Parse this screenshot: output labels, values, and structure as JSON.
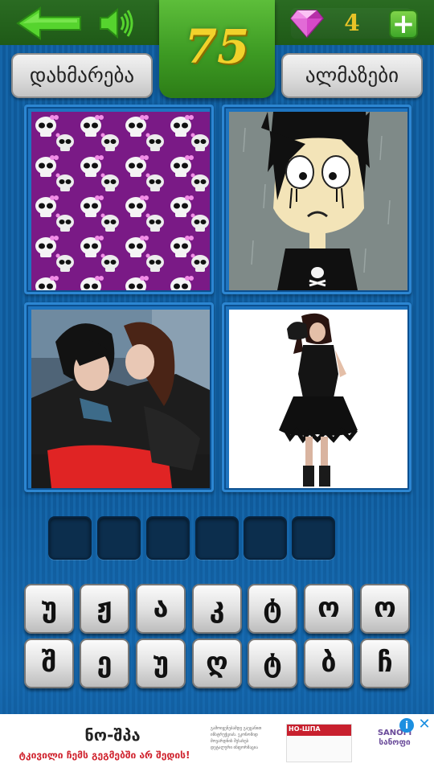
{
  "header": {
    "level": "75",
    "gems": "4",
    "add_label": "+"
  },
  "buttons": {
    "help": "დახმარება",
    "gems": "ალმაზები"
  },
  "pictures": [
    {
      "name": "skull-pattern-picture"
    },
    {
      "name": "sad-emo-cartoon-picture"
    },
    {
      "name": "emo-couple-picture"
    },
    {
      "name": "girl-black-dress-picture"
    }
  ],
  "answer": {
    "slot_count": 6
  },
  "keyboard": {
    "row1": [
      "უ",
      "ჟ",
      "ა",
      "კ",
      "ტ",
      "ო",
      "ო"
    ],
    "row2": [
      "შ",
      "ე",
      "უ",
      "ღ",
      "ტ",
      "ბ",
      "ჩ"
    ]
  },
  "ad": {
    "title": "ნო-შპა",
    "subtitle": "ტკივილი ჩემს გეგმებში არ შედის!",
    "fine_print": "გამოიყენებამდე გაეცანით ინსტრუქციას. ეკონომიდ მოვარდნის შესახებ დეტალური ინფორმაცია",
    "product_name": "НО-ШПА",
    "brand_latin": "SANOFI",
    "brand_georgian": "სანოფი",
    "info_icon": "i",
    "close_icon": "✕"
  },
  "colors": {
    "topbar": "#2a6b22",
    "level_box": "#3d9a23",
    "level_digits": "#f2d22b",
    "gem": "#d649c8",
    "background": "#1565a8",
    "slot": "#0c2e4d"
  }
}
